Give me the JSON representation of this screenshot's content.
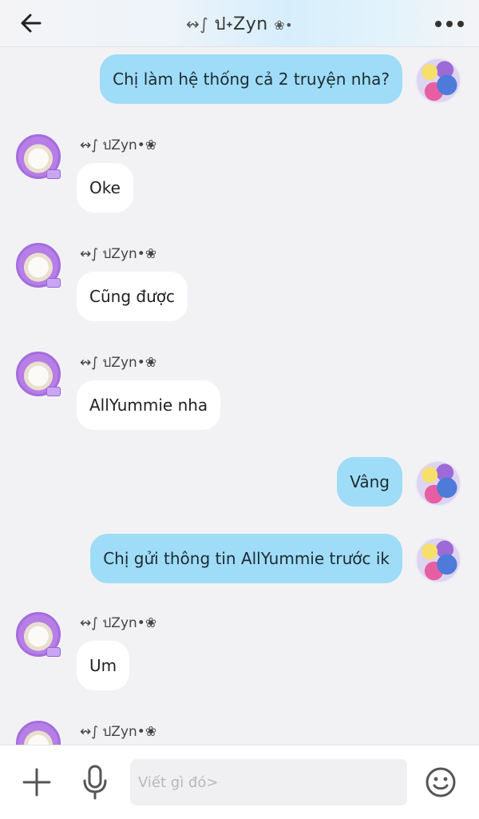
{
  "header": {
    "title": "⊰∫·໒Zynཹོཋ་ང་"
  },
  "messages": [
    {
      "side": "out",
      "text": "Chị làm hệ thống cả 2 truyện nha?"
    },
    {
      "side": "in",
      "sender": "Zyn",
      "text": "Oke"
    },
    {
      "side": "in",
      "sender": "Zyn",
      "text": "Cũng được"
    },
    {
      "side": "in",
      "sender": "Zyn",
      "text": "AllYummie nha"
    },
    {
      "side": "out",
      "text": "Vâng"
    },
    {
      "side": "out",
      "text": "Chị gửi thông tin AllYummie trước ik"
    },
    {
      "side": "in",
      "sender": "Zyn",
      "text": "Um"
    },
    {
      "side": "in",
      "sender": "Zyn",
      "text": ""
    }
  ],
  "sender_name": "·໒Zyn•ཋ•",
  "composer": {
    "placeholder": "Viết gì đó>"
  },
  "colors": {
    "outgoing_bubble": "#9fdcf7",
    "incoming_bubble": "#ffffff",
    "background": "#f2f2f4"
  },
  "icons": {
    "back": "arrow-left-icon",
    "more": "more-dots-icon",
    "plus": "plus-icon",
    "mic": "microphone-icon",
    "emoji": "emoji-smile-icon"
  }
}
